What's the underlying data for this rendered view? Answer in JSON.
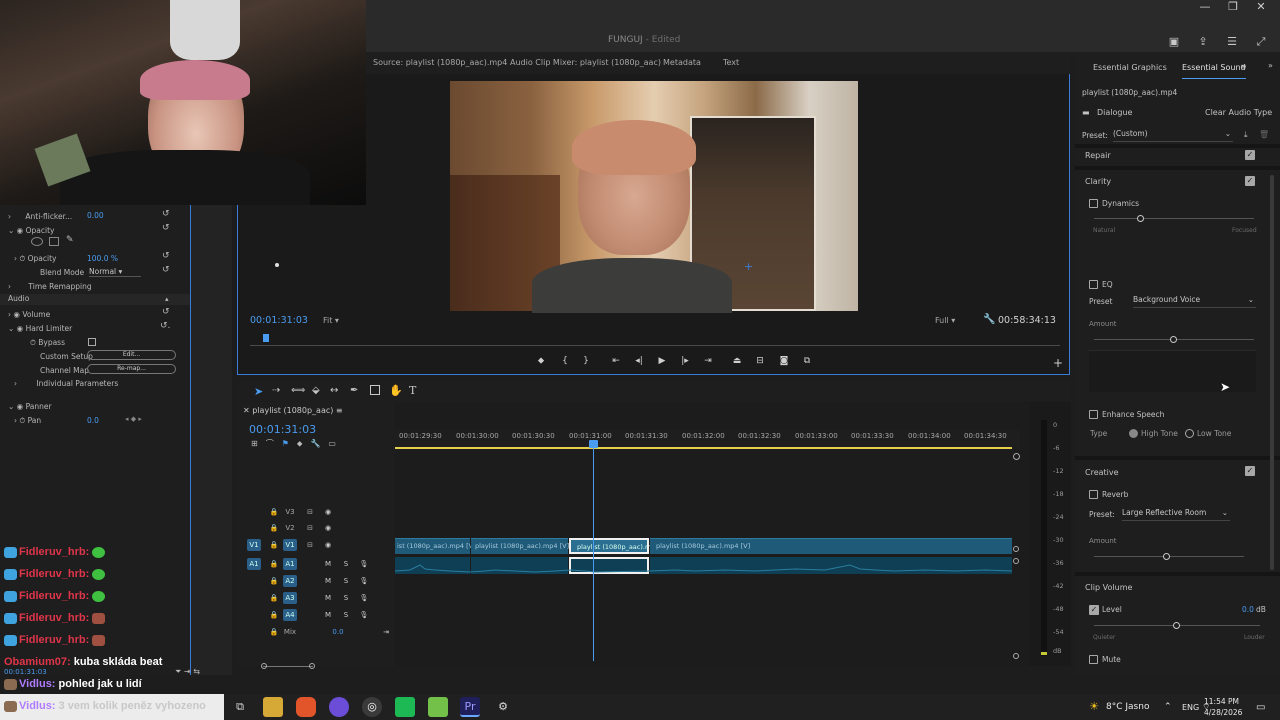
{
  "window": {
    "title": "FUNGUJ",
    "edited": "- Edited",
    "controls": [
      "—",
      "❐",
      "✕"
    ]
  },
  "source_tabs": [
    "Source: playlist (1080p_aac).mp4",
    "Audio Clip Mixer: playlist (1080p_aac)",
    "Metadata",
    "Text"
  ],
  "program": {
    "timecode": "00:01:31:03",
    "fit": "Fit",
    "quality": "Full",
    "duration": "00:58:34:13"
  },
  "effects": {
    "anti_flicker_label": "Anti-flicker...",
    "anti_flicker_value": "0.00",
    "opacity_section": "Opacity",
    "opacity_label": "Opacity",
    "opacity_value": "100.0 %",
    "blend_label": "Blend Mode",
    "blend_value": "Normal",
    "time_remapping": "Time Remapping",
    "audio": "Audio",
    "volume": "Volume",
    "hard_limiter": "Hard Limiter",
    "bypass": "Bypass",
    "custom_setup": "Custom Setup",
    "custom_setup_btn": "Edit...",
    "channel_map": "Channel Map",
    "channel_map_btn": "Re-map...",
    "individual_params": "Individual Parameters",
    "panner": "Panner",
    "pan_label": "Pan",
    "pan_value": "0.0",
    "bottom_time": "00:01:31:03"
  },
  "timeline": {
    "sequence_name": "playlist (1080p_aac)",
    "timecode": "00:01:31:03",
    "ruler": [
      "00:01:29:30",
      "00:01:30:00",
      "00:01:30:30",
      "00:01:31:00",
      "00:01:31:30",
      "00:01:32:00",
      "00:01:32:30",
      "00:01:33:00",
      "00:01:33:30",
      "00:01:34:00",
      "00:01:34:30"
    ],
    "video_tracks": [
      "V3",
      "V2",
      "V1"
    ],
    "audio_tracks": [
      "A1",
      "A2",
      "A3",
      "A4"
    ],
    "mix_label": "Mix",
    "mix_value": "0.0",
    "clip_label": "playlist (1080p_aac).mp4 [V]",
    "clip_label_left": "ist (1080p_aac).mp4 [V]",
    "meter_labels": [
      "0",
      "-6",
      "-12",
      "-18",
      "-24",
      "-30",
      "-36",
      "-42",
      "-48",
      "-54",
      "dB"
    ]
  },
  "essential_sound": {
    "tabs": [
      "Essential Graphics",
      "Essential Sound"
    ],
    "clip_name": "playlist (1080p_aac).mp4",
    "type": "Dialogue",
    "clear_btn": "Clear Audio Type",
    "preset_label": "Preset:",
    "preset_value": "(Custom)",
    "repair": "Repair",
    "clarity": "Clarity",
    "dynamics": "Dynamics",
    "natural": "Natural",
    "focused": "Focused",
    "eq": "EQ",
    "eq_preset_label": "Preset",
    "eq_preset_value": "Background Voice",
    "amount": "Amount",
    "enhance_speech": "Enhance Speech",
    "type_label": "Type",
    "high_tone": "High Tone",
    "low_tone": "Low Tone",
    "creative": "Creative",
    "reverb": "Reverb",
    "reverb_preset_label": "Preset:",
    "reverb_preset_value": "Large Reflective Room",
    "reverb_amount": "Amount",
    "clip_volume": "Clip Volume",
    "level": "Level",
    "level_value": "0.0",
    "db": "dB",
    "quiet": "Quieter",
    "louder": "Louder",
    "mute": "Mute"
  },
  "chat": [
    {
      "user": "Fidleruv_hrb:",
      "msg": "",
      "color": "#e0354a"
    },
    {
      "user": "Fidleruv_hrb:",
      "msg": "",
      "color": "#e0354a"
    },
    {
      "user": "Fidleruv_hrb:",
      "msg": "",
      "color": "#e0354a"
    },
    {
      "user": "Fidleruv_hrb:",
      "msg": "",
      "color": "#e0354a"
    },
    {
      "user": "Fidleruv_hrb:",
      "msg": "",
      "color": "#e0354a"
    },
    {
      "user": "Obamium07:",
      "msg": "kuba skláda beat",
      "color": "#e0354a"
    },
    {
      "user": "Vidlus:",
      "msg": "pohled jak u lidí",
      "color": "#b07cff"
    },
    {
      "user": "Vidlus:",
      "msg": "3 vem kolik peněz vyhozeno",
      "color": "#b07cff"
    }
  ],
  "taskbar": {
    "weather": "8°C",
    "weather_text": "Jasno",
    "lang": "ENG",
    "time": "11:54 PM",
    "date": "4/28/2026"
  }
}
